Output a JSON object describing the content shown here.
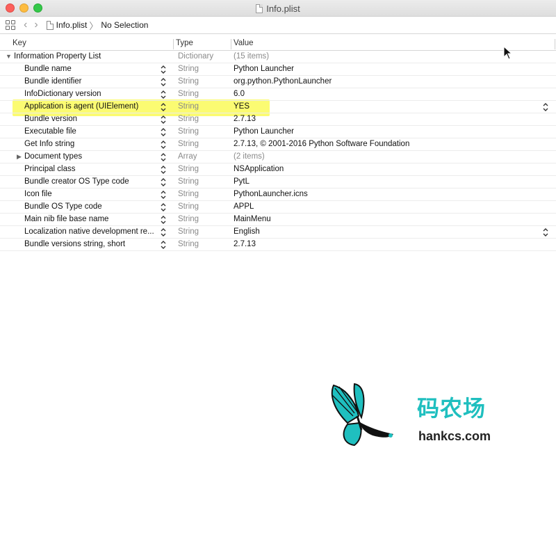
{
  "window": {
    "title": "Info.plist"
  },
  "jumpbar": {
    "file": "Info.plist",
    "selection": "No Selection"
  },
  "columns": {
    "key": "Key",
    "type": "Type",
    "value": "Value"
  },
  "rows": [
    {
      "key": "Information Property List",
      "type": "Dictionary",
      "value": "(15 items)",
      "root": true
    },
    {
      "key": "Bundle name",
      "type": "String",
      "value": "Python Launcher"
    },
    {
      "key": "Bundle identifier",
      "type": "String",
      "value": "org.python.PythonLauncher"
    },
    {
      "key": "InfoDictionary version",
      "type": "String",
      "value": "6.0"
    },
    {
      "key": "Application is agent (UIElement)",
      "type": "String",
      "value": "YES",
      "highlighted": true
    },
    {
      "key": "Bundle version",
      "type": "String",
      "value": "2.7.13"
    },
    {
      "key": "Executable file",
      "type": "String",
      "value": "Python Launcher"
    },
    {
      "key": "Get Info string",
      "type": "String",
      "value": "2.7.13, © 2001-2016 Python Software Foundation"
    },
    {
      "key": "Document types",
      "type": "Array",
      "value": "(2 items)",
      "collapsed": true
    },
    {
      "key": "Principal class",
      "type": "String",
      "value": "NSApplication"
    },
    {
      "key": "Bundle creator OS Type code",
      "type": "String",
      "value": "PytL"
    },
    {
      "key": "Icon file",
      "type": "String",
      "value": "PythonLauncher.icns"
    },
    {
      "key": "Bundle OS Type code",
      "type": "String",
      "value": "APPL"
    },
    {
      "key": "Main nib file base name",
      "type": "String",
      "value": "MainMenu"
    },
    {
      "key": "Localization native development re...",
      "type": "String",
      "value": "English"
    },
    {
      "key": "Bundle versions string, short",
      "type": "String",
      "value": "2.7.13"
    }
  ],
  "watermark": {
    "cn": "码农场",
    "en": "hankcs.com"
  },
  "colors": {
    "highlight": "#fafa3c",
    "watermark_accent": "#1fbfbf"
  }
}
